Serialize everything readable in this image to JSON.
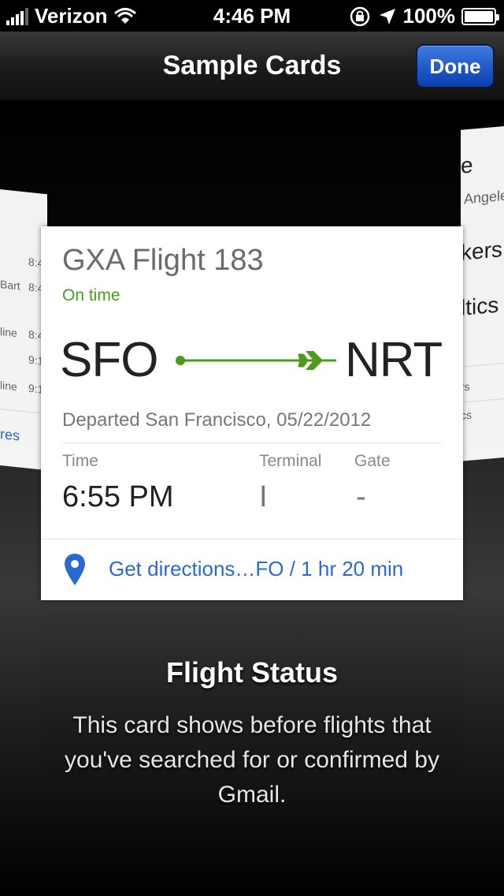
{
  "statusbar": {
    "carrier": "Verizon",
    "time": "4:46 PM",
    "battery": "100%",
    "icons": [
      "signal-bars-icon",
      "wifi-icon",
      "orientation-lock-icon",
      "location-arrow-icon",
      "battery-icon"
    ]
  },
  "navbar": {
    "title": "Sample Cards",
    "done_label": "Done",
    "done_color": "#1f5fd0"
  },
  "card": {
    "flight": "GXA Flight 183",
    "status": "On time",
    "status_color": "#4c9b1e",
    "origin": "SFO",
    "destination": "NRT",
    "departed": "Departed San Francisco, 05/22/2012",
    "labels": {
      "time": "Time",
      "terminal": "Terminal",
      "gate": "Gate"
    },
    "values": {
      "time": "6:55 PM",
      "terminal": "I",
      "gate": "-"
    },
    "directions": "Get directions…FO / 1 hr 20 min",
    "link_color": "#2a6ad0"
  },
  "left_card": {
    "times": [
      "8:4",
      "8:4",
      "8:4",
      "9:1",
      "9:1"
    ],
    "rows": [
      "",
      "Bart",
      "line",
      "line"
    ],
    "link": "res"
  },
  "right_card": {
    "header": "e",
    "subheader": "Angeles",
    "teams": [
      "kers",
      "ltics"
    ],
    "rows": [
      "rs",
      "cs"
    ]
  },
  "caption": {
    "title": "Flight Status",
    "body": "This card shows before flights that you've searched for or confirmed by Gmail."
  }
}
